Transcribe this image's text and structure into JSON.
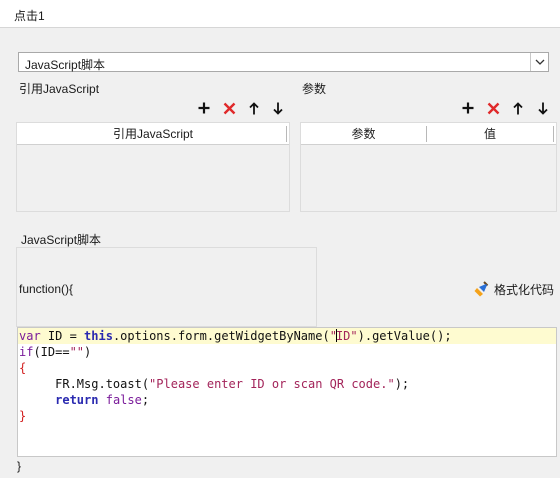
{
  "window": {
    "title": "点击1"
  },
  "script_type": {
    "selected": "JavaScript脚本"
  },
  "ref_section": {
    "label": "引用JavaScript",
    "column": "引用JavaScript"
  },
  "param_section": {
    "label": "参数",
    "columns": [
      "参数",
      "值"
    ]
  },
  "toolbar_icons": [
    "plus-icon",
    "delete-icon",
    "arrow-up-icon",
    "arrow-down-icon"
  ],
  "script_section": {
    "label": "JavaScript脚本",
    "function_header": "function(){",
    "format_label": "格式化代码",
    "code_lines": [
      "var ID = this.options.form.getWidgetByName(\"ID\").getValue();",
      "if(ID==\"\")",
      "{",
      "     FR.Msg.toast(\"Please enter ID or scan QR code.\");",
      "     return false;",
      "}"
    ],
    "closing": "}"
  },
  "colors": {
    "keyword": "#7a1b9a",
    "string": "#a3245a",
    "brace": "#d21f1f",
    "delete": "#e0292a",
    "active_line": "#fefbd0"
  }
}
